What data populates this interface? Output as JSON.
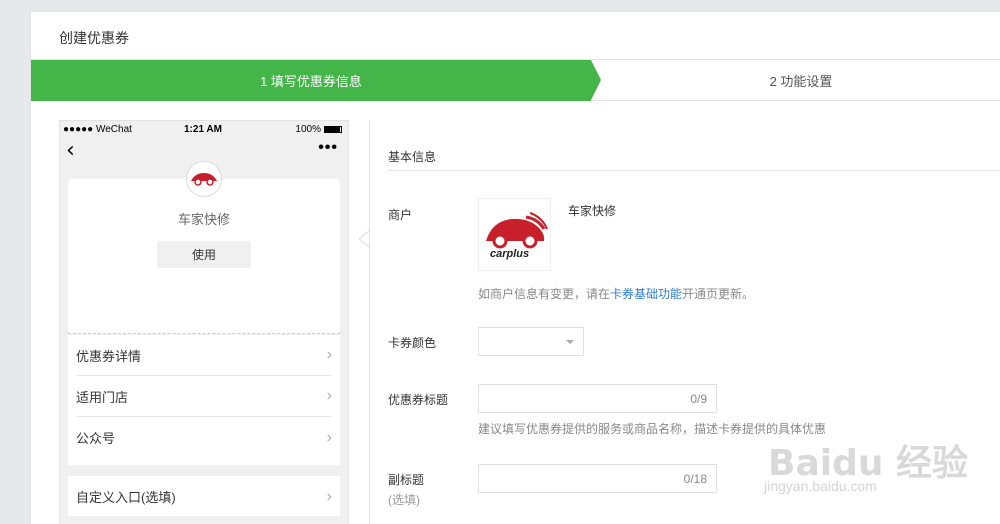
{
  "page": {
    "title": "创建优惠券"
  },
  "steps": [
    {
      "label": "1 填写优惠券信息",
      "active": true
    },
    {
      "label": "2 功能设置",
      "active": false
    }
  ],
  "colors": {
    "accent": "#44b549",
    "link": "#2e7dd1"
  },
  "phone": {
    "status": {
      "carrier": "●●●●● WeChat",
      "time": "1:21 AM",
      "battery": "100%"
    },
    "coupon": {
      "merchant": "车家快修",
      "use_button": "使用"
    },
    "menu": [
      "优惠券详情",
      "适用门店",
      "公众号"
    ],
    "custom_entry": "自定义入口(选填)"
  },
  "form": {
    "section_title": "基本信息",
    "merchant_label": "商户",
    "merchant_name": "车家快修",
    "merchant_logo_text": "carplus",
    "merchant_hint_prefix": "如商户信息有变更，请在",
    "merchant_hint_link": "卡券基础功能",
    "merchant_hint_suffix": "开通页更新。",
    "color_label": "卡券颜色",
    "title_label": "优惠券标题",
    "title_count": "0/9",
    "title_hint": "建议填写优惠券提供的服务或商品名称，描述卡券提供的具体优惠",
    "subtitle_label": "副标题",
    "subtitle_optional": "(选填)",
    "subtitle_count": "0/18"
  },
  "watermark": {
    "main": "Baidu 经验",
    "sub": "jingyan.baidu.com"
  }
}
